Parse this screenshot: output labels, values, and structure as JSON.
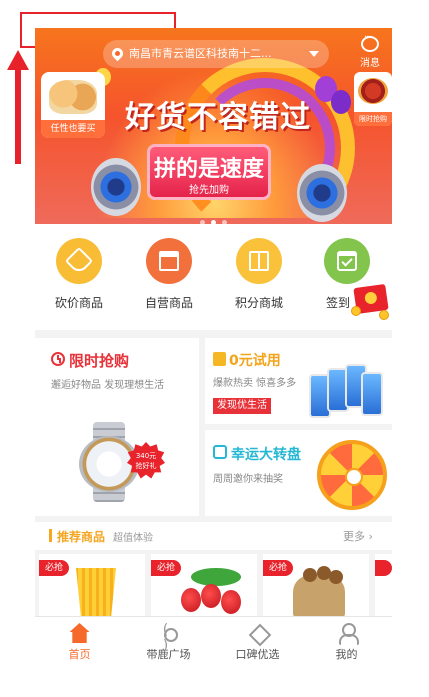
{
  "header": {
    "location": "南昌市青云谱区科技南十二...",
    "message_label": "消息"
  },
  "banner": {
    "slogan": "好货不容错过",
    "board_title": "拼的是速度",
    "board_sub": "抢先加购",
    "left_thumb_tag": "任性也要买",
    "right_thumb_tag": "限时抢购"
  },
  "categories": [
    {
      "label": "砍价商品",
      "color": "#f8bd35",
      "icon": "tag-icon"
    },
    {
      "label": "自营商品",
      "color": "#f2703c",
      "icon": "store-icon"
    },
    {
      "label": "积分商城",
      "color": "#f9c23a",
      "icon": "gift-icon"
    },
    {
      "label": "签到",
      "color": "#82c44c",
      "icon": "calendar-check-icon"
    }
  ],
  "promos": {
    "flash": {
      "title": "限时抢购",
      "subtitle": "邂逅好物品 发现理想生活",
      "badge_line1": "340元",
      "badge_line2": "抢好礼"
    },
    "trial": {
      "title": "0元试用",
      "subtitle": "爆款热卖 惊喜多多",
      "badge": "发现优生活"
    },
    "wheel": {
      "title": "幸运大转盘",
      "subtitle": "周周邀你来抽奖"
    }
  },
  "recommend": {
    "title": "推荐商品",
    "subtitle": "超值体验",
    "more": "更多",
    "ribbon": "必抢"
  },
  "tabs": [
    {
      "label": "首页",
      "icon": "home-icon",
      "active": true
    },
    {
      "label": "带鹿广场",
      "icon": "broadcast-icon",
      "active": false
    },
    {
      "label": "口碑优选",
      "icon": "diamond-icon",
      "active": false
    },
    {
      "label": "我的",
      "icon": "user-icon",
      "active": false
    }
  ],
  "colors": {
    "accent": "#f56a2a",
    "annotation": "#e8222b"
  }
}
